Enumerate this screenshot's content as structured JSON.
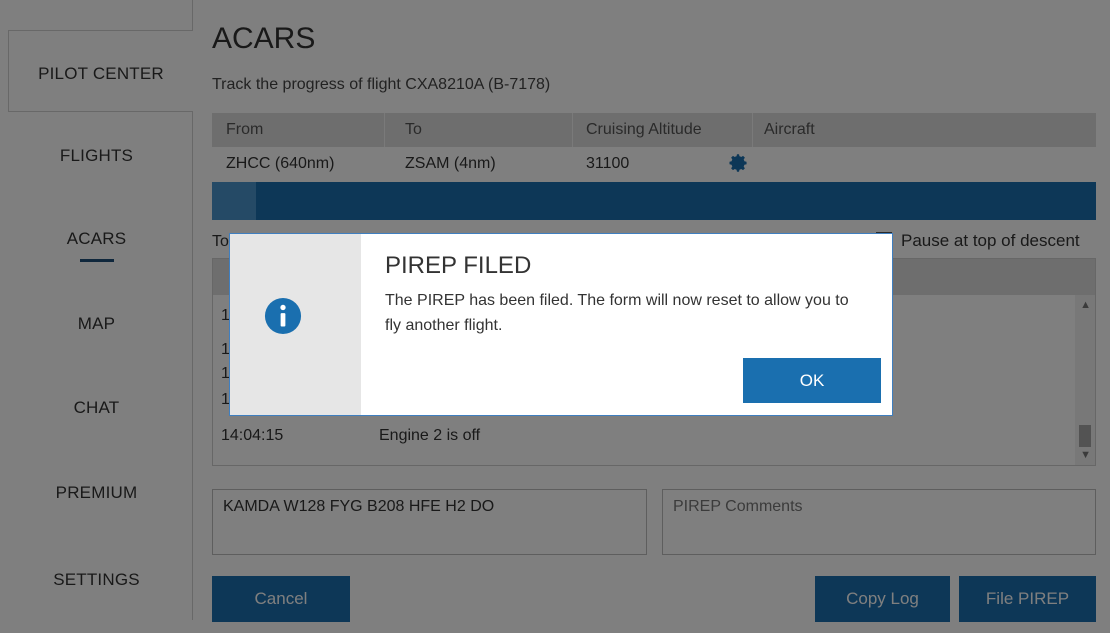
{
  "sidebar": {
    "items": [
      {
        "label": "PILOT CENTER"
      },
      {
        "label": "FLIGHTS"
      },
      {
        "label": "ACARS"
      },
      {
        "label": "MAP"
      },
      {
        "label": "CHAT"
      },
      {
        "label": "PREMIUM"
      },
      {
        "label": "SETTINGS"
      }
    ]
  },
  "main": {
    "title": "ACARS",
    "subtitle": "Track the progress of flight CXA8210A (B-7178)",
    "columns": [
      "From",
      "To",
      "Cruising Altitude",
      "Aircraft"
    ],
    "row": {
      "from": "ZHCC (640nm)",
      "to": "ZSAM (4nm)",
      "altitude": "31100"
    },
    "progress_fraction": 0.05,
    "partial_label": "To",
    "pause_label": "Pause at top of descent",
    "log": [
      {
        "time": "1",
        "message": ""
      },
      {
        "time": "1",
        "message": ""
      },
      {
        "time": "1",
        "message": ""
      },
      {
        "time": "1",
        "message": ""
      },
      {
        "time": "14:04:15",
        "message": "Engine 2 is off"
      }
    ],
    "route": "KAMDA W128 FYG B208 HFE H2 DO",
    "comments_placeholder": "PIREP Comments",
    "buttons": {
      "cancel": "Cancel",
      "copy_log": "Copy Log",
      "file_pirep": "File PIREP"
    }
  },
  "dialog": {
    "title": "PIREP FILED",
    "message": "The PIREP has been filed. The form will now reset to allow you to fly another flight.",
    "ok": "OK"
  },
  "colors": {
    "accent": "#1a6faf",
    "navy": "#1f4e79"
  }
}
